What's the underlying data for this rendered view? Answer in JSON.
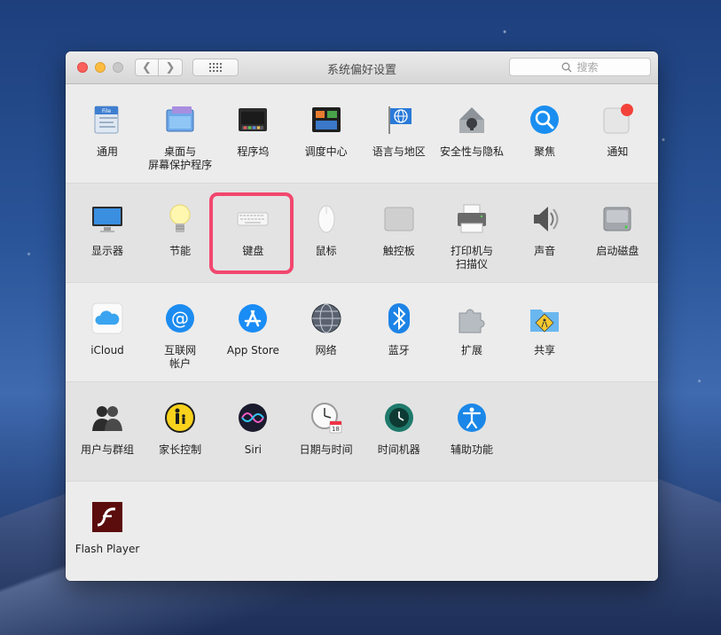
{
  "window": {
    "title": "系统偏好设置",
    "search_placeholder": "搜索",
    "nav_back": "❮",
    "nav_forward": "❯"
  },
  "rows": [
    [
      {
        "label": "通用",
        "icon": "general-icon"
      },
      {
        "label": "桌面与\n屏幕保护程序",
        "icon": "desktop-screensaver-icon"
      },
      {
        "label": "程序坞",
        "icon": "dock-icon"
      },
      {
        "label": "调度中心",
        "icon": "mission-control-icon"
      },
      {
        "label": "语言与地区",
        "icon": "language-region-icon"
      },
      {
        "label": "安全性与隐私",
        "icon": "security-privacy-icon"
      },
      {
        "label": "聚焦",
        "icon": "spotlight-icon"
      },
      {
        "label": "通知",
        "icon": "notifications-icon"
      }
    ],
    [
      {
        "label": "显示器",
        "icon": "displays-icon"
      },
      {
        "label": "节能",
        "icon": "energy-saver-icon"
      },
      {
        "label": "键盘",
        "icon": "keyboard-icon"
      },
      {
        "label": "鼠标",
        "icon": "mouse-icon"
      },
      {
        "label": "触控板",
        "icon": "trackpad-icon"
      },
      {
        "label": "打印机与\n扫描仪",
        "icon": "printer-scanner-icon"
      },
      {
        "label": "声音",
        "icon": "sound-icon"
      },
      {
        "label": "启动磁盘",
        "icon": "startup-disk-icon"
      }
    ],
    [
      {
        "label": "iCloud",
        "icon": "icloud-icon"
      },
      {
        "label": "互联网\n帐户",
        "icon": "internet-accounts-icon"
      },
      {
        "label": "App Store",
        "icon": "app-store-icon"
      },
      {
        "label": "网络",
        "icon": "network-icon"
      },
      {
        "label": "蓝牙",
        "icon": "bluetooth-icon"
      },
      {
        "label": "扩展",
        "icon": "extensions-icon"
      },
      {
        "label": "共享",
        "icon": "sharing-icon"
      }
    ],
    [
      {
        "label": "用户与群组",
        "icon": "users-groups-icon"
      },
      {
        "label": "家长控制",
        "icon": "parental-controls-icon"
      },
      {
        "label": "Siri",
        "icon": "siri-icon"
      },
      {
        "label": "日期与时间",
        "icon": "date-time-icon"
      },
      {
        "label": "时间机器",
        "icon": "time-machine-icon"
      },
      {
        "label": "辅助功能",
        "icon": "accessibility-icon"
      }
    ],
    [
      {
        "label": "Flash Player",
        "icon": "flash-player-icon"
      }
    ]
  ],
  "highlighted_item": "键盘",
  "colors": {
    "highlight": "#f2476f",
    "notification_badge": "#f2423a"
  }
}
